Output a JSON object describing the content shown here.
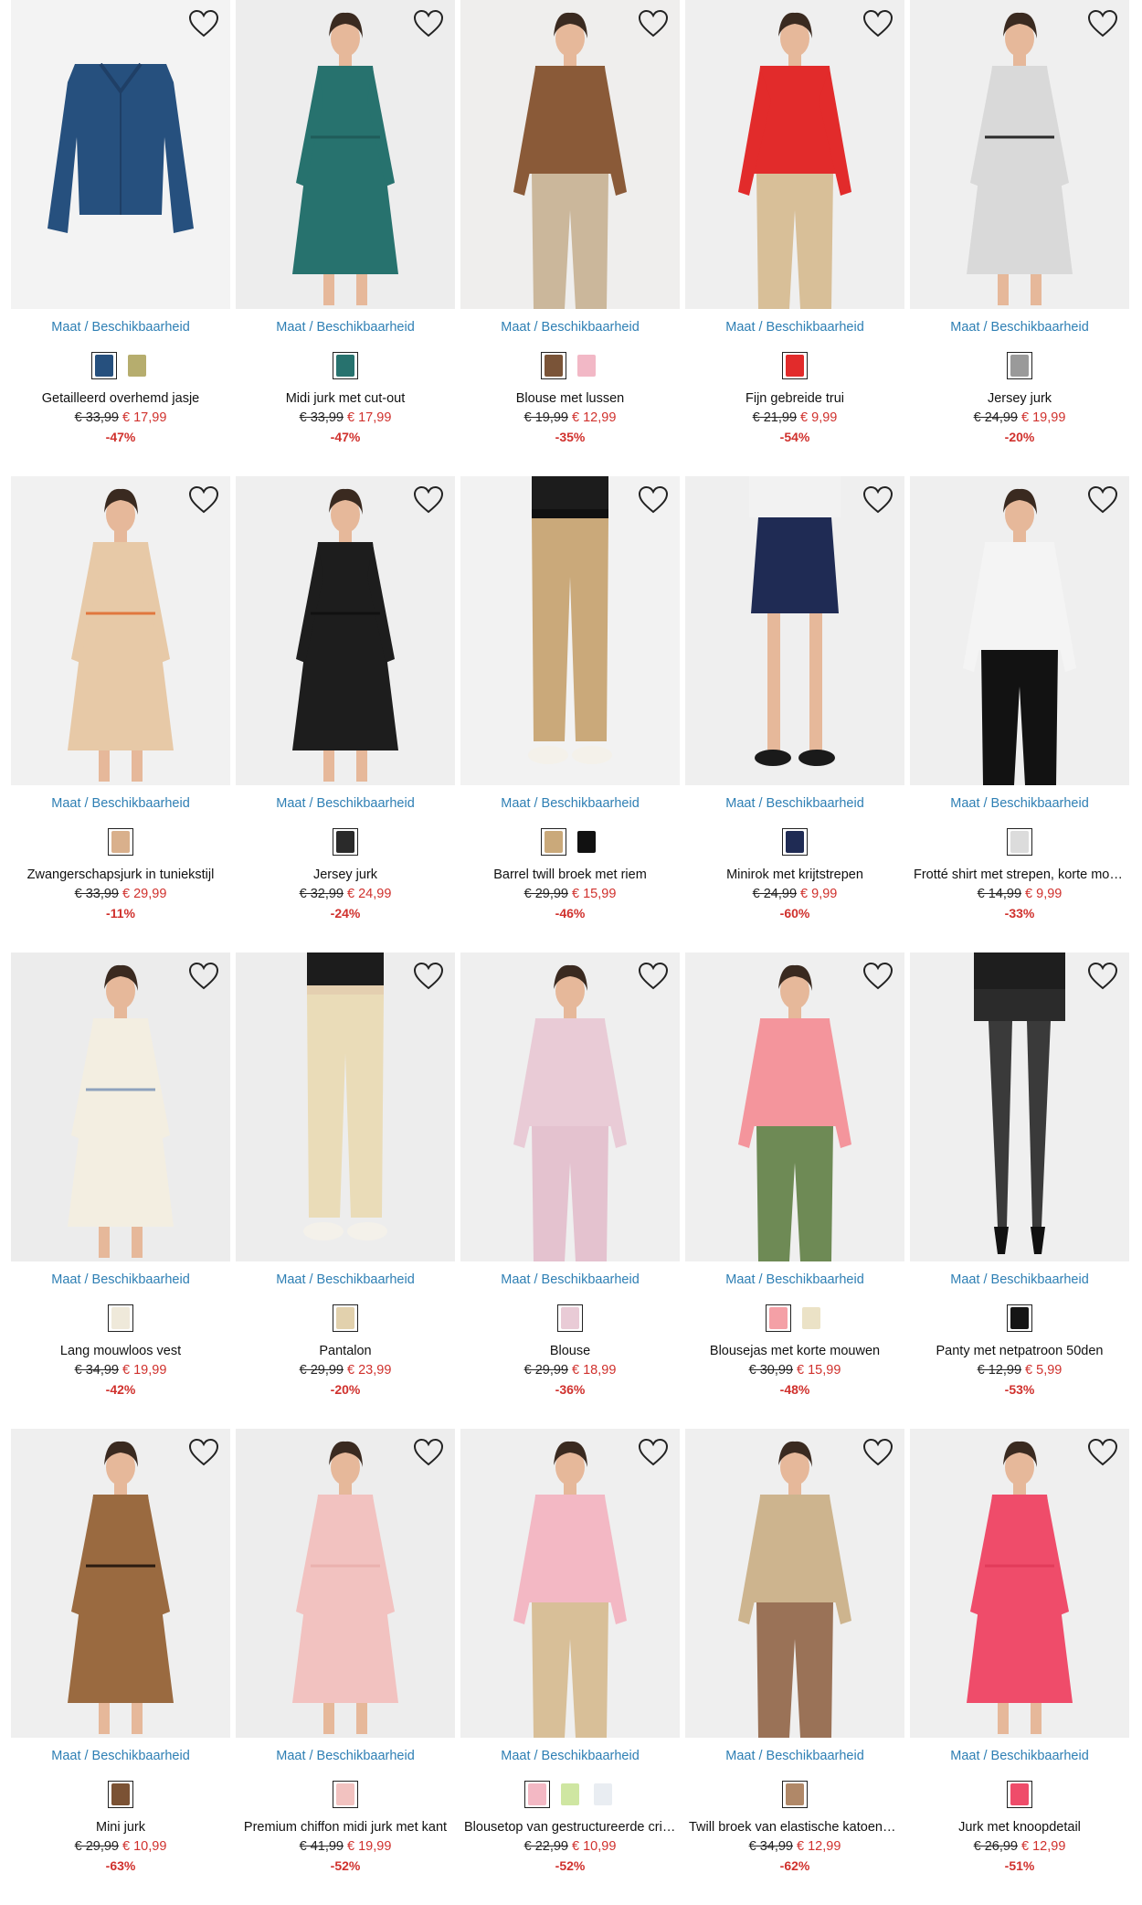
{
  "size_link_label": "Maat / Beschikbaarheid",
  "products": [
    {
      "title": "Getailleerd overhemd jasje",
      "old_price": "€ 33,99",
      "new_price": "€ 17,99",
      "discount": "-47%",
      "bg": "#f3f3f3",
      "figure": "jacket",
      "main": "#26507e",
      "accent": "#1f3f66",
      "swatches": [
        "#26507e",
        "#b6ad6e"
      ]
    },
    {
      "title": "Midi jurk met cut-out",
      "old_price": "€ 33,99",
      "new_price": "€ 17,99",
      "discount": "-47%",
      "bg": "#ededed",
      "figure": "dress",
      "main": "#27726e",
      "accent": "#1f5c59",
      "swatches": [
        "#27726e"
      ]
    },
    {
      "title": "Blouse met lussen",
      "old_price": "€ 19,99",
      "new_price": "€ 12,99",
      "discount": "-35%",
      "bg": "#efeeed",
      "figure": "top-pants",
      "main": "#8a5a38",
      "accent": "#cbb79b",
      "swatches": [
        "#7a5438",
        "#f2b8c6"
      ]
    },
    {
      "title": "Fijn gebreide trui",
      "old_price": "€ 21,99",
      "new_price": "€ 9,99",
      "discount": "-54%",
      "bg": "#efefef",
      "figure": "top-pants",
      "main": "#e22b2b",
      "accent": "#d8bf98",
      "swatches": [
        "#e22b2b"
      ]
    },
    {
      "title": "Jersey jurk",
      "old_price": "€ 24,99",
      "new_price": "€ 19,99",
      "discount": "-20%",
      "bg": "#efefef",
      "figure": "dress",
      "main": "#d9d9d9",
      "accent": "#2a2a2a",
      "swatches": [
        "#9a9a9a"
      ]
    },
    {
      "title": "Zwangerschapsjurk in tuniekstijl",
      "old_price": "€ 33,99",
      "new_price": "€ 29,99",
      "discount": "-11%",
      "bg": "#f1f1f1",
      "figure": "dress",
      "main": "#e7c9a7",
      "accent": "#e0773e",
      "swatches": [
        "#d9b08c"
      ]
    },
    {
      "title": "Jersey jurk",
      "old_price": "€ 32,99",
      "new_price": "€ 24,99",
      "discount": "-24%",
      "bg": "#efefef",
      "figure": "dress",
      "main": "#1d1d1d",
      "accent": "#111111",
      "swatches": [
        "#2a2a2a"
      ]
    },
    {
      "title": "Barrel twill broek met riem",
      "old_price": "€ 29,99",
      "new_price": "€ 15,99",
      "discount": "-46%",
      "bg": "#f2f2f2",
      "figure": "pants",
      "main": "#caa97a",
      "accent": "#111111",
      "swatches": [
        "#caa97a",
        "#111111"
      ]
    },
    {
      "title": "Minirok met krijtstrepen",
      "old_price": "€ 24,99",
      "new_price": "€ 9,99",
      "discount": "-60%",
      "bg": "#efefef",
      "figure": "skirt",
      "main": "#1f2b54",
      "accent": "#f2f2f2",
      "swatches": [
        "#1f2b54"
      ]
    },
    {
      "title": "Frotté shirt met strepen, korte mouw",
      "old_price": "€ 14,99",
      "new_price": "€ 9,99",
      "discount": "-33%",
      "bg": "#efefef",
      "figure": "top-pants",
      "main": "#f4f4f4",
      "accent": "#121212",
      "swatches": [
        "#dcdcdc"
      ]
    },
    {
      "title": "Lang mouwloos vest",
      "old_price": "€ 34,99",
      "new_price": "€ 19,99",
      "discount": "-42%",
      "bg": "#ececec",
      "figure": "dress",
      "main": "#f3eee1",
      "accent": "#8ea2bd",
      "swatches": [
        "#efe9da"
      ]
    },
    {
      "title": "Pantalon",
      "old_price": "€ 29,99",
      "new_price": "€ 23,99",
      "discount": "-20%",
      "bg": "#ededed",
      "figure": "pants",
      "main": "#eadcb8",
      "accent": "#e4cfb0",
      "swatches": [
        "#e2d1ad"
      ]
    },
    {
      "title": "Blouse",
      "old_price": "€ 29,99",
      "new_price": "€ 18,99",
      "discount": "-36%",
      "bg": "#efefef",
      "figure": "top-pants",
      "main": "#e9cbd6",
      "accent": "#e4c2cf",
      "swatches": [
        "#e9cbd6"
      ]
    },
    {
      "title": "Blousejas met korte mouwen",
      "old_price": "€ 30,99",
      "new_price": "€ 15,99",
      "discount": "-48%",
      "bg": "#efefef",
      "figure": "top-pants",
      "main": "#f4959c",
      "accent": "#6e8a55",
      "swatches": [
        "#f4a0a6",
        "#ebe2c6"
      ]
    },
    {
      "title": "Panty met netpatroon 50den",
      "old_price": "€ 12,99",
      "new_price": "€ 5,99",
      "discount": "-53%",
      "bg": "#efefef",
      "figure": "legs",
      "main": "#1a1a1a",
      "accent": "#222222",
      "swatches": [
        "#151515"
      ]
    },
    {
      "title": "Mini jurk",
      "old_price": "€ 29,99",
      "new_price": "€ 10,99",
      "discount": "-63%",
      "bg": "#efefef",
      "figure": "dress",
      "main": "#9a6a40",
      "accent": "#2b1b10",
      "swatches": [
        "#7b5234"
      ]
    },
    {
      "title": "Premium chiffon midi jurk met kant",
      "old_price": "€ 41,99",
      "new_price": "€ 19,99",
      "discount": "-52%",
      "bg": "#ededed",
      "figure": "dress",
      "main": "#f2c2c0",
      "accent": "#eab1ae",
      "swatches": [
        "#f2c2c0"
      ]
    },
    {
      "title": "Blousetop van gestructureerde crinkle",
      "old_price": "€ 22,99",
      "new_price": "€ 10,99",
      "discount": "-52%",
      "bg": "#efefef",
      "figure": "top-pants",
      "main": "#f3b8c4",
      "accent": "#d8bf98",
      "swatches": [
        "#f3b8c4",
        "#cfe6a2",
        "#e9edf2"
      ]
    },
    {
      "title": "Twill broek van elastische katoenmix",
      "old_price": "€ 34,99",
      "new_price": "€ 12,99",
      "discount": "-62%",
      "bg": "#efefef",
      "figure": "top-pants",
      "main": "#cdb48e",
      "accent": "#9a7257",
      "swatches": [
        "#b08868"
      ]
    },
    {
      "title": "Jurk met knoopdetail",
      "old_price": "€ 26,99",
      "new_price": "€ 12,99",
      "discount": "-51%",
      "bg": "#efefef",
      "figure": "dress",
      "main": "#ef4c6a",
      "accent": "#e23b5a",
      "swatches": [
        "#ef4c6a"
      ]
    }
  ]
}
